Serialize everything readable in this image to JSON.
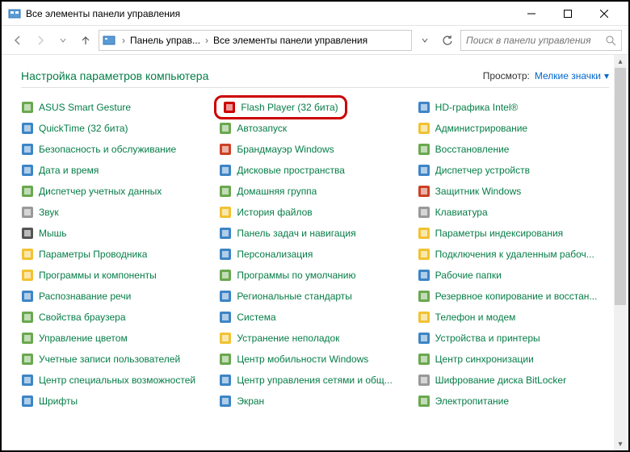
{
  "window": {
    "title": "Все элементы панели управления"
  },
  "breadcrumb": {
    "seg1": "Панель управ...",
    "seg2": "Все элементы панели управления"
  },
  "search": {
    "placeholder": "Поиск в панели управления"
  },
  "heading": "Настройка параметров компьютера",
  "view": {
    "label": "Просмотр:",
    "value": "Мелкие значки"
  },
  "items": {
    "c1": [
      "ASUS Smart Gesture",
      "QuickTime (32 бита)",
      "Безопасность и обслуживание",
      "Дата и время",
      "Диспетчер учетных данных",
      "Звук",
      "Мышь",
      "Параметры Проводника",
      "Программы и компоненты",
      "Распознавание речи",
      "Свойства браузера",
      "Управление цветом",
      "Учетные записи пользователей",
      "Центр специальных возможностей",
      "Шрифты"
    ],
    "c2": [
      "Flash Player (32 бита)",
      "Автозапуск",
      "Брандмауэр Windows",
      "Дисковые пространства",
      "Домашняя группа",
      "История файлов",
      "Панель задач и навигация",
      "Персонализация",
      "Программы по умолчанию",
      "Региональные стандарты",
      "Система",
      "Устранение неполадок",
      "Центр мобильности Windows",
      "Центр управления сетями и общ...",
      "Экран"
    ],
    "c3": [
      "HD-графика Intel®",
      "Администрирование",
      "Восстановление",
      "Диспетчер устройств",
      "Защитник Windows",
      "Клавиатура",
      "Параметры индексирования",
      "Подключения к удаленным рабоч...",
      "Рабочие папки",
      "Резервное копирование и восстан...",
      "Телефон и модем",
      "Устройства и принтеры",
      "Центр синхронизации",
      "Шифрование диска BitLocker",
      "Электропитание"
    ]
  },
  "icons": {
    "c1": [
      "#6aa84f",
      "#3d85c6",
      "#3d85c6",
      "#3d85c6",
      "#6aa84f",
      "#999",
      "#555",
      "#f1c232",
      "#f1c232",
      "#3d85c6",
      "#6aa84f",
      "#6aa84f",
      "#6aa84f",
      "#3d85c6",
      "#3d85c6"
    ],
    "c2": [
      "#cc0000",
      "#6aa84f",
      "#cc4125",
      "#3d85c6",
      "#6aa84f",
      "#f1c232",
      "#3d85c6",
      "#3d85c6",
      "#6aa84f",
      "#3d85c6",
      "#3d85c6",
      "#f1c232",
      "#6aa84f",
      "#3d85c6",
      "#3d85c6"
    ],
    "c3": [
      "#3d85c6",
      "#f1c232",
      "#6aa84f",
      "#3d85c6",
      "#cc4125",
      "#999",
      "#f1c232",
      "#f1c232",
      "#3d85c6",
      "#6aa84f",
      "#f1c232",
      "#3d85c6",
      "#6aa84f",
      "#999",
      "#6aa84f"
    ]
  }
}
